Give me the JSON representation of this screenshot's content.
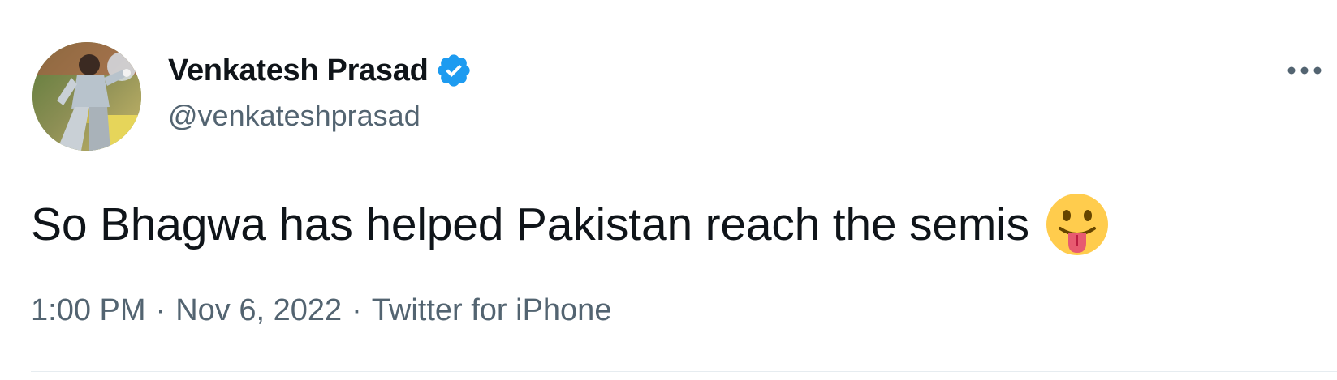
{
  "author": {
    "name": "Venkatesh Prasad",
    "handle": "@venkateshprasad",
    "verified": true,
    "avatar_description_icon": "profile-photo"
  },
  "tweet": {
    "text": "So Bhagwa has helped Pakistan reach the semis",
    "emoji_icon": "face-with-tongue-emoji"
  },
  "meta": {
    "time": "1:00 PM",
    "separator": "·",
    "date": "Nov 6, 2022",
    "source": "Twitter for iPhone"
  },
  "colors": {
    "verified_blue": "#1d9bf0",
    "secondary_text": "#536471",
    "primary_text": "#0f1419"
  }
}
